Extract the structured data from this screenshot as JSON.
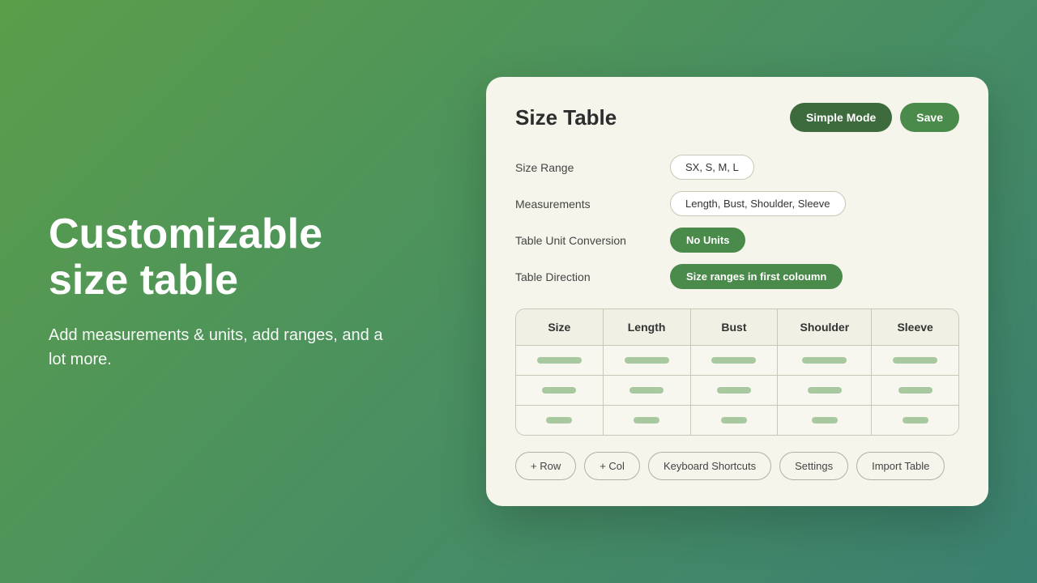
{
  "left": {
    "heading_line1": "Customizable",
    "heading_line2": "size table",
    "description": "Add measurements & units, add ranges, and a lot more."
  },
  "card": {
    "title": "Size Table",
    "header_buttons": {
      "simple_mode": "Simple Mode",
      "save": "Save"
    },
    "settings": {
      "size_range_label": "Size Range",
      "size_range_value": "SX, S, M, L",
      "measurements_label": "Measurements",
      "measurements_value": "Length, Bust, Shoulder, Sleeve",
      "unit_conversion_label": "Table Unit Conversion",
      "unit_conversion_value": "No Units",
      "table_direction_label": "Table Direction",
      "table_direction_value": "Size ranges in first coloumn"
    },
    "table": {
      "headers": [
        "Size",
        "Length",
        "Bust",
        "Shoulder",
        "Sleeve"
      ],
      "rows": [
        [
          "long",
          "long",
          "long",
          "long",
          "long"
        ],
        [
          "medium",
          "medium",
          "medium",
          "medium",
          "medium"
        ],
        [
          "short",
          "short",
          "short",
          "short",
          "short"
        ]
      ]
    },
    "bottom_buttons": [
      "+ Row",
      "+ Col",
      "Keyboard Shortcuts",
      "Settings",
      "Import Table"
    ]
  }
}
